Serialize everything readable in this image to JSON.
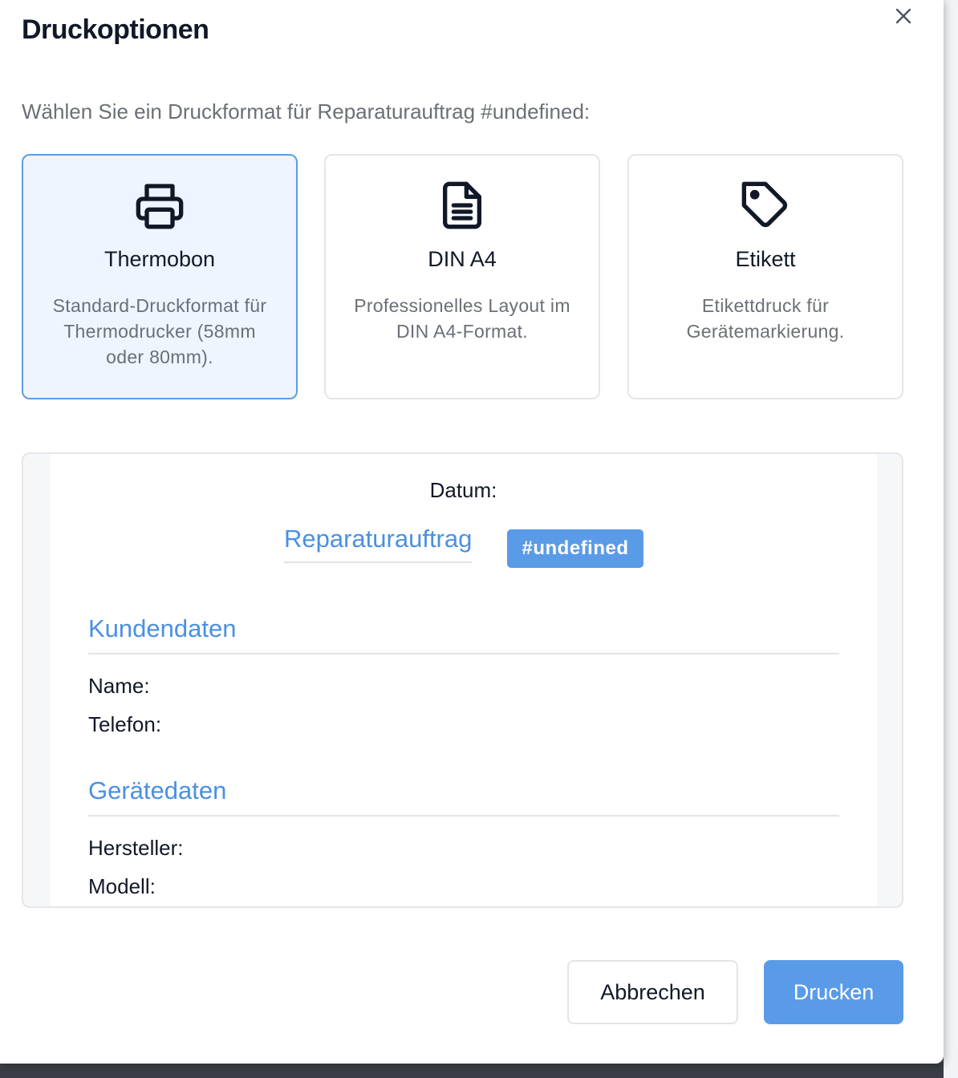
{
  "dialog": {
    "title": "Druckoptionen",
    "subtitle": "Wählen Sie ein Druckformat für Reparaturauftrag #undefined:",
    "close_icon": "close-icon"
  },
  "options": [
    {
      "id": "thermobon",
      "icon": "printer-icon",
      "title": "Thermobon",
      "description": "Standard-Druckformat für Thermodrucker (58mm oder 80mm).",
      "selected": true
    },
    {
      "id": "din-a4",
      "icon": "document-icon",
      "title": "DIN A4",
      "description": "Professionelles Layout im DIN A4-Format.",
      "selected": false
    },
    {
      "id": "etikett",
      "icon": "tag-icon",
      "title": "Etikett",
      "description": "Etikettdruck für Gerätemarkierung.",
      "selected": false
    }
  ],
  "preview": {
    "datum_label": "Datum:",
    "order_heading": "Reparaturauftrag",
    "order_number": "#undefined",
    "customer_section": "Kundendaten",
    "name_label": "Name:",
    "phone_label": "Telefon:",
    "device_section": "Gerätedaten",
    "manufacturer_label": "Hersteller:",
    "model_label": "Modell:"
  },
  "actions": {
    "cancel_label": "Abbrechen",
    "print_label": "Drucken"
  },
  "colors": {
    "accent": "#5a9be8",
    "heading_blue": "#4a90e2",
    "selected_bg": "#eef5fe",
    "text_dark": "#111827",
    "text_muted": "#6b6f76"
  }
}
